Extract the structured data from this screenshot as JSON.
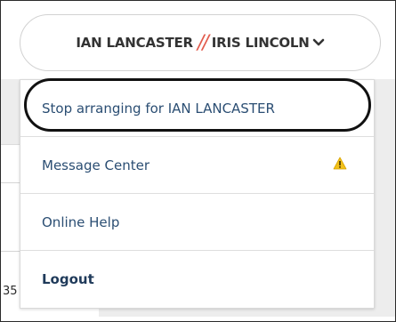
{
  "switcher": {
    "primary_user": "IAN LANCASTER",
    "separator": "//",
    "secondary_user": "IRIS LINCOLN"
  },
  "menu": {
    "items": [
      {
        "label": "Stop arranging for IAN LANCASTER"
      },
      {
        "label": "Message Center",
        "icon": "warning-icon"
      },
      {
        "label": "Online Help"
      },
      {
        "label": "Logout"
      }
    ]
  },
  "background": {
    "partial_text": "35"
  },
  "colors": {
    "separator": "#e25c4d",
    "menu_text": "#2b4e73",
    "warning": "#f2c11a"
  }
}
